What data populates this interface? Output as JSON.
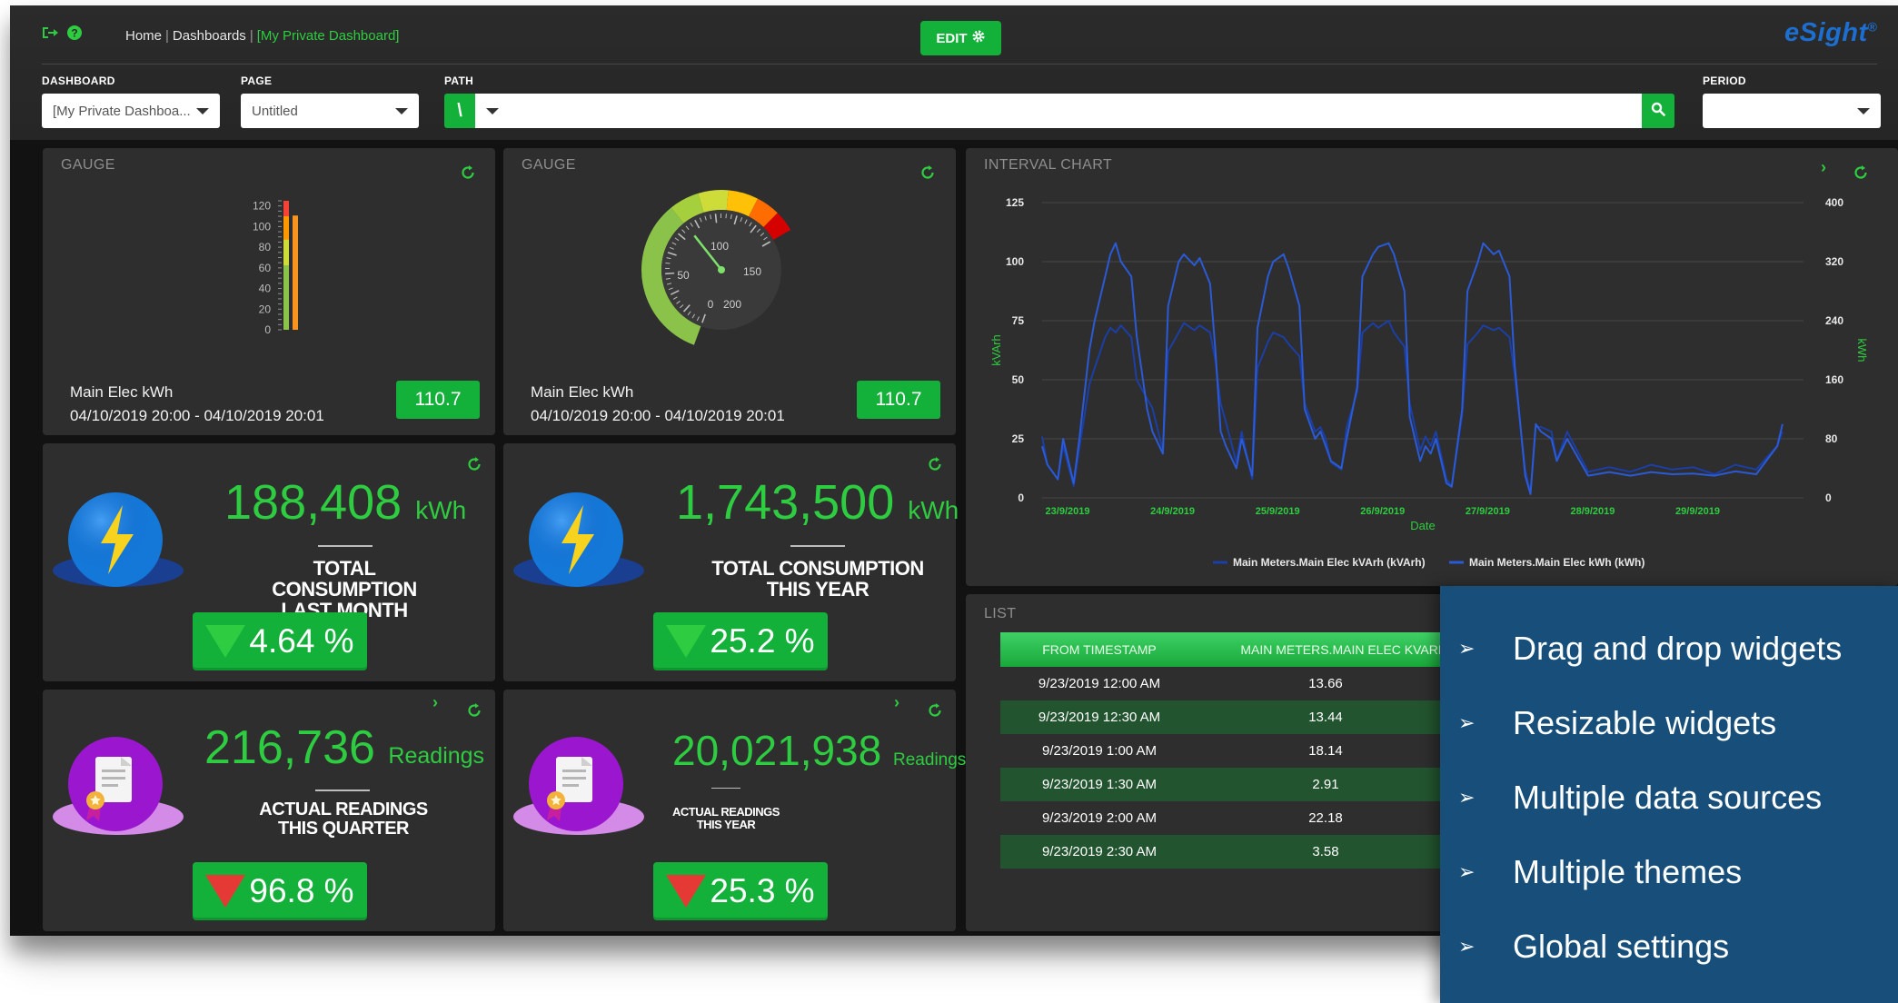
{
  "breadcrumb": {
    "home": "Home",
    "dashboards": "Dashboards",
    "current": "[My Private Dashboard]"
  },
  "header": {
    "edit_label": "EDIT",
    "logo": "eSight",
    "logo_mark": "®"
  },
  "filters": {
    "dashboard": {
      "label": "DASHBOARD",
      "value": "[My Private Dashboa..."
    },
    "page": {
      "label": "PAGE",
      "value": "Untitled"
    },
    "path": {
      "label": "PATH",
      "root": "\\",
      "value": ""
    },
    "period": {
      "label": "PERIOD",
      "value": ""
    }
  },
  "gauge_bar": {
    "title": "GAUGE",
    "ticks": [
      "120",
      "100",
      "80",
      "60",
      "40",
      "20",
      "0"
    ],
    "level": 110.7,
    "max": 125,
    "label": "Main Elec kWh",
    "range": "04/10/2019 20:00 - 04/10/2019 20:01",
    "value": "110.7"
  },
  "gauge_dial": {
    "title": "GAUGE",
    "ticks": [
      "0",
      "50",
      "100",
      "150",
      "200"
    ],
    "level": 110.7,
    "label": "Main Elec kWh",
    "range": "04/10/2019 20:00 - 04/10/2019 20:01",
    "value": "110.7"
  },
  "kpis": [
    {
      "value": "188,408",
      "unit": "kWh",
      "title1": "TOTAL CONSUMPTION",
      "title2": "LAST MONTH",
      "change": "4.64 %",
      "direction": "down",
      "color": "#2ecc40"
    },
    {
      "value": "1,743,500",
      "unit": "kWh",
      "title1": "TOTAL CONSUMPTION",
      "title2": "THIS YEAR",
      "change": "25.2 %",
      "direction": "down",
      "color": "#2ecc40"
    },
    {
      "value": "216,736",
      "unit": "Readings",
      "title1": "ACTUAL READINGS",
      "title2": "THIS QUARTER",
      "change": "96.8 %",
      "direction": "down",
      "color": "#e53935"
    },
    {
      "value": "20,021,938",
      "unit": "Readings",
      "title1": "ACTUAL READINGS",
      "title2": "THIS YEAR",
      "change": "25.3 %",
      "direction": "down",
      "color": "#e53935"
    }
  ],
  "interval_chart": {
    "title": "INTERVAL CHART",
    "chart_data": {
      "type": "line",
      "xlabel": "Date",
      "ylabel_left": "kVArh",
      "ylabel_right": "kWh",
      "yticks_left": [
        "125",
        "100",
        "75",
        "50",
        "25",
        "0"
      ],
      "yticks_right": [
        "400",
        "320",
        "240",
        "160",
        "80",
        "0"
      ],
      "ylim_left": [
        0,
        125
      ],
      "ylim_right": [
        0,
        400
      ],
      "x_ticks": [
        "23/9/2019",
        "24/9/2019",
        "25/9/2019",
        "26/9/2019",
        "27/9/2019",
        "28/9/2019",
        "29/9/2019"
      ],
      "grid": true,
      "legend_position": "bottom",
      "series": [
        {
          "name": "Main Meters.Main Elec kVArh (kVArh)",
          "axis": "left",
          "color": "#1b3fa6",
          "x": [
            0,
            0.05,
            0.15,
            0.2,
            0.3,
            0.35,
            0.45,
            0.5,
            0.6,
            0.65,
            0.7,
            0.75,
            0.85,
            0.9,
            1,
            1.05,
            1.15,
            1.2,
            1.3,
            1.35,
            1.45,
            1.5,
            1.6,
            1.65,
            1.7,
            1.75,
            1.85,
            1.9,
            2,
            2.05,
            2.15,
            2.2,
            2.3,
            2.35,
            2.45,
            2.5,
            2.6,
            2.65,
            2.7,
            2.75,
            2.85,
            2.9,
            3,
            3.05,
            3.15,
            3.2,
            3.3,
            3.35,
            3.45,
            3.5,
            3.6,
            3.65,
            3.7,
            3.75,
            3.85,
            3.9,
            4,
            4.05,
            4.15,
            4.2,
            4.3,
            4.35,
            4.45,
            4.5,
            4.6,
            4.65,
            4.7,
            4.75,
            4.85,
            4.9,
            5,
            5.2,
            5.4,
            5.6,
            5.8,
            6,
            6.2,
            6.4,
            6.6,
            6.8,
            7,
            7.05
          ],
          "y": [
            26,
            14,
            8,
            22,
            5,
            20,
            48,
            55,
            68,
            72,
            70,
            73,
            68,
            50,
            42,
            38,
            20,
            62,
            70,
            74,
            71,
            73,
            70,
            58,
            40,
            32,
            15,
            28,
            8,
            55,
            66,
            70,
            68,
            65,
            60,
            40,
            28,
            30,
            25,
            15,
            12,
            30,
            45,
            70,
            74,
            72,
            75,
            70,
            64,
            40,
            20,
            26,
            22,
            28,
            8,
            5,
            35,
            65,
            70,
            73,
            71,
            72,
            68,
            52,
            12,
            2,
            30,
            30,
            28,
            16,
            28,
            11,
            13,
            11,
            14,
            12,
            13,
            10,
            14,
            12,
            22,
            28
          ]
        },
        {
          "name": "Main Meters.Main Elec kWh (kWh)",
          "axis": "right",
          "color": "#2b5ad6",
          "x": [
            0,
            0.05,
            0.15,
            0.2,
            0.3,
            0.35,
            0.45,
            0.5,
            0.6,
            0.65,
            0.7,
            0.75,
            0.85,
            0.9,
            1,
            1.05,
            1.15,
            1.2,
            1.3,
            1.35,
            1.45,
            1.5,
            1.6,
            1.65,
            1.7,
            1.75,
            1.85,
            1.9,
            2,
            2.05,
            2.15,
            2.2,
            2.3,
            2.35,
            2.45,
            2.5,
            2.6,
            2.65,
            2.7,
            2.75,
            2.85,
            2.9,
            3,
            3.05,
            3.15,
            3.2,
            3.3,
            3.35,
            3.45,
            3.5,
            3.6,
            3.65,
            3.7,
            3.75,
            3.85,
            3.9,
            4,
            4.05,
            4.15,
            4.2,
            4.3,
            4.35,
            4.45,
            4.5,
            4.6,
            4.65,
            4.7,
            4.75,
            4.85,
            4.9,
            5,
            5.2,
            5.4,
            5.6,
            5.8,
            6,
            6.2,
            6.4,
            6.6,
            6.8,
            7,
            7.05
          ],
          "y": [
            70,
            45,
            25,
            80,
            20,
            75,
            200,
            240,
            300,
            330,
            345,
            320,
            300,
            220,
            120,
            90,
            60,
            260,
            320,
            330,
            315,
            325,
            290,
            200,
            90,
            70,
            40,
            80,
            30,
            230,
            300,
            320,
            330,
            310,
            260,
            120,
            80,
            90,
            70,
            50,
            40,
            80,
            150,
            300,
            330,
            340,
            345,
            330,
            280,
            110,
            50,
            70,
            60,
            80,
            20,
            15,
            120,
            280,
            320,
            345,
            330,
            335,
            300,
            180,
            30,
            5,
            100,
            90,
            80,
            50,
            80,
            30,
            35,
            30,
            35,
            32,
            33,
            30,
            36,
            32,
            70,
            100
          ]
        }
      ]
    }
  },
  "list": {
    "title": "LIST",
    "columns": [
      "FROM TIMESTAMP",
      "MAIN METERS.MAIN ELEC KVARH"
    ],
    "rows": [
      [
        "9/23/2019 12:00 AM",
        "13.66"
      ],
      [
        "9/23/2019 12:30 AM",
        "13.44"
      ],
      [
        "9/23/2019 1:00 AM",
        "18.14"
      ],
      [
        "9/23/2019 1:30 AM",
        "2.91"
      ],
      [
        "9/23/2019 2:00 AM",
        "22.18"
      ],
      [
        "9/23/2019 2:30 AM",
        "3.58"
      ]
    ]
  },
  "features": [
    "Drag and drop widgets",
    "Resizable widgets",
    "Multiple data sources",
    "Multiple themes",
    "Global settings"
  ],
  "colors": {
    "accent": "#13b13a",
    "panel": "#2e2e2e",
    "feature_panel": "#174e7a"
  }
}
